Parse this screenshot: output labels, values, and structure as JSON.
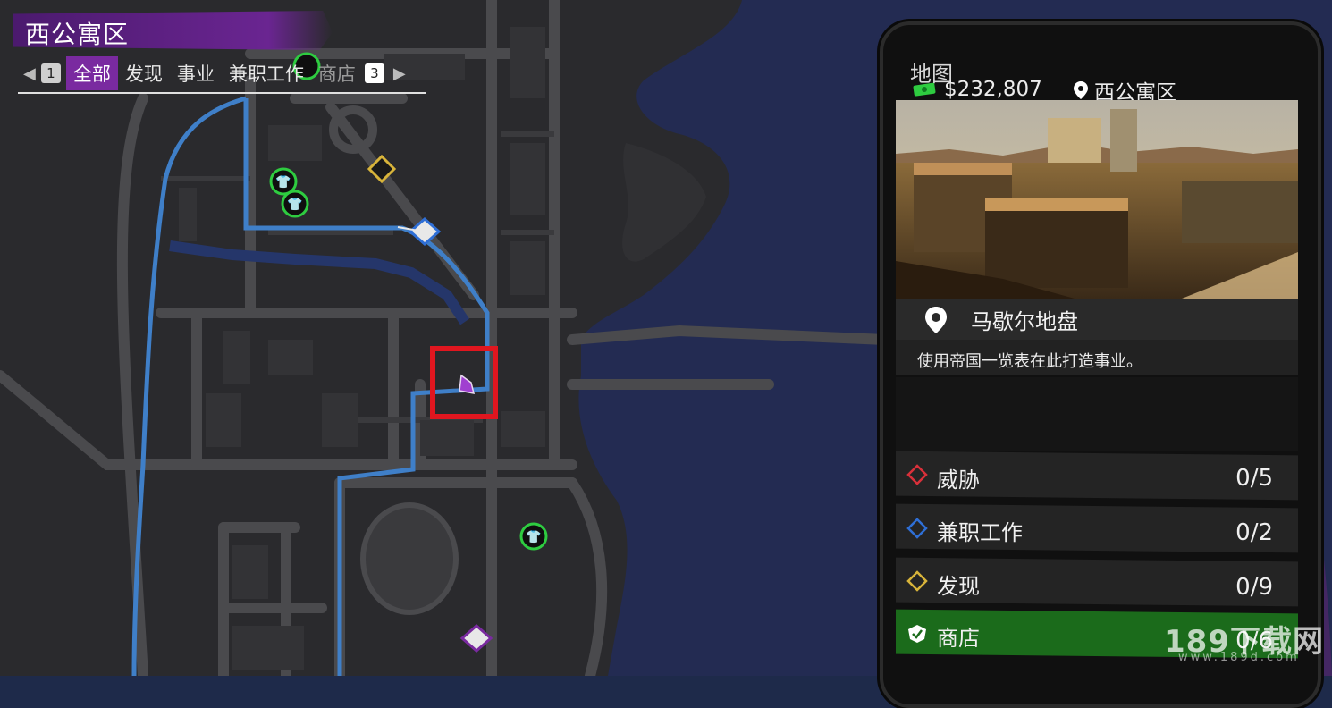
{
  "district": {
    "name": "西公寓区"
  },
  "filters": {
    "left_key": "1",
    "right_key": "3",
    "tabs": [
      {
        "label": "全部",
        "active": true
      },
      {
        "label": "发现",
        "active": false
      },
      {
        "label": "事业",
        "active": false
      },
      {
        "label": "兼职工作",
        "active": false
      },
      {
        "label": "商店",
        "active": false
      }
    ]
  },
  "phone": {
    "title": "地图",
    "money": "$232,807",
    "location": "西公寓区",
    "place": {
      "name": "马歇尔地盘",
      "description": "使用帝国一览表在此打造事业。"
    },
    "stats": [
      {
        "label": "威胁",
        "count": "0/5",
        "icon": "red-diamond-icon",
        "color": "#d9303a"
      },
      {
        "label": "兼职工作",
        "count": "0/2",
        "icon": "blue-diamond-icon",
        "color": "#2f6fd6"
      },
      {
        "label": "发现",
        "count": "0/9",
        "icon": "yellow-diamond-icon",
        "color": "#d8b43a"
      },
      {
        "label": "商店",
        "count": "0/6",
        "icon": "check-badge-icon",
        "color": "#1b6b1b"
      }
    ]
  },
  "watermark": {
    "text": "189下载网",
    "url": "www.189d.com"
  },
  "colors": {
    "accent_purple": "#7a2aa0",
    "map_water": "#232b52",
    "map_land": "#2a2a2d",
    "road": "#4a4a4d",
    "route_blue": "#3f7fc8",
    "highlight_red": "#e0161f"
  }
}
